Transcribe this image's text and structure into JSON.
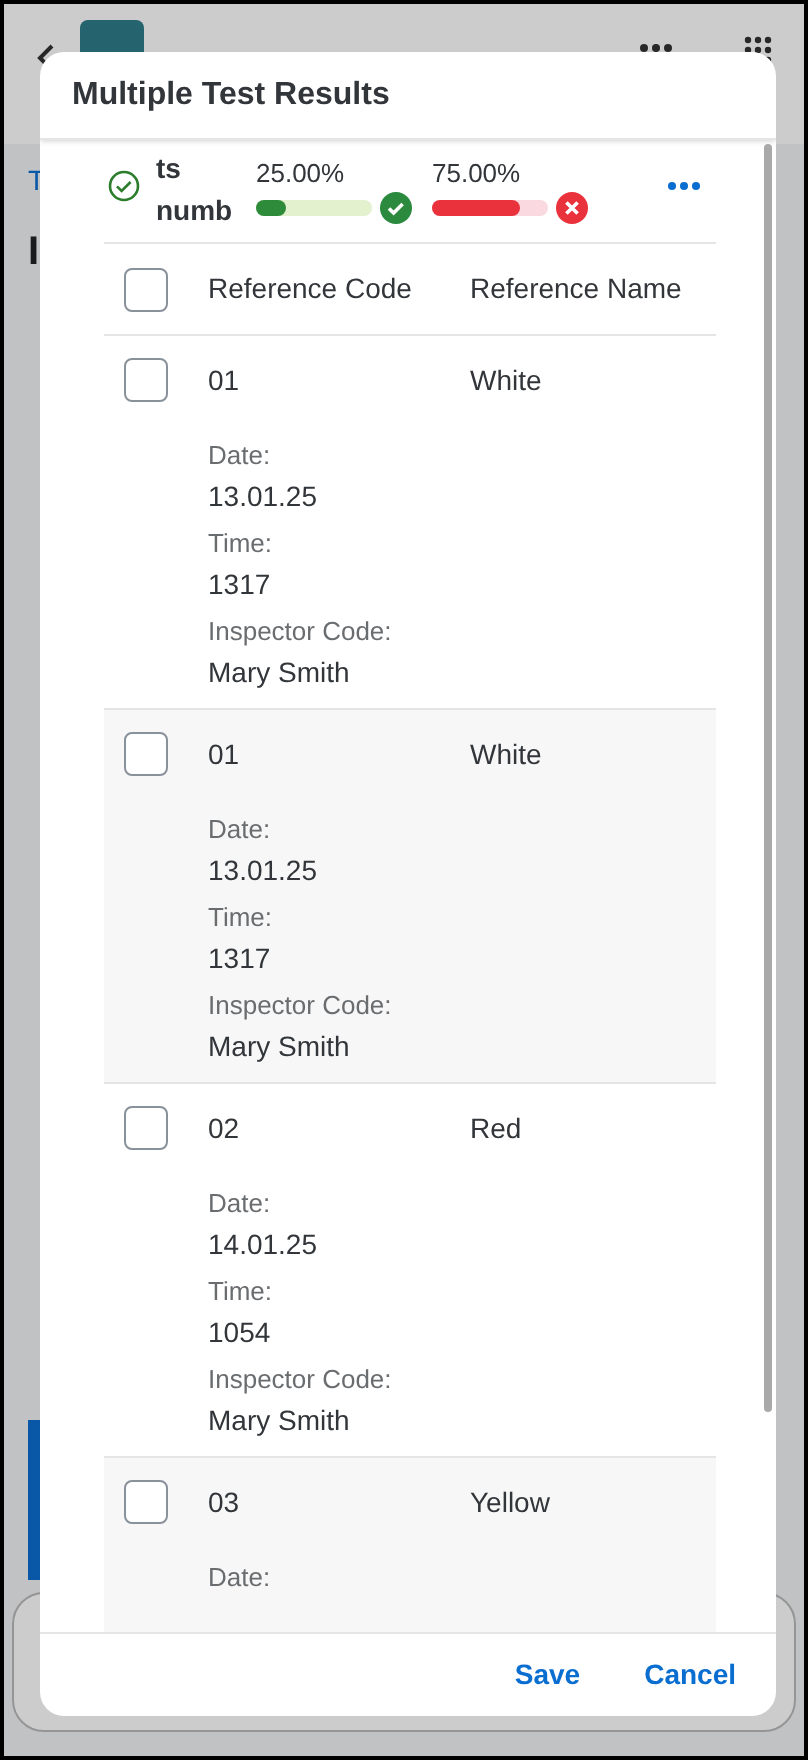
{
  "background": {
    "fragments": [
      "T",
      "I"
    ]
  },
  "dialog": {
    "title": "Multiple Test Results",
    "summary": {
      "label": "ts numb",
      "results": [
        {
          "reading": "25.00%",
          "level": 0.25,
          "kind": "pass"
        },
        {
          "reading": "75.00%",
          "level": 0.75,
          "kind": "fail"
        }
      ]
    },
    "table": {
      "columns": [
        "Reference Code",
        "Reference Name"
      ],
      "header_checked": false,
      "rows": [
        {
          "checked": false,
          "code": "01",
          "name": "White",
          "details": [
            {
              "label": "Date:",
              "value": "13.01.25"
            },
            {
              "label": "Time:",
              "value": "1317"
            },
            {
              "label": "Inspector Code:",
              "value": "Mary Smith"
            }
          ]
        },
        {
          "checked": false,
          "code": "01",
          "name": "White",
          "details": [
            {
              "label": "Date:",
              "value": "13.01.25"
            },
            {
              "label": "Time:",
              "value": "1317"
            },
            {
              "label": "Inspector Code:",
              "value": "Mary Smith"
            }
          ]
        },
        {
          "checked": false,
          "code": "02",
          "name": "Red",
          "details": [
            {
              "label": "Date:",
              "value": "14.01.25"
            },
            {
              "label": "Time:",
              "value": "1054"
            },
            {
              "label": "Inspector Code:",
              "value": "Mary Smith"
            }
          ]
        },
        {
          "checked": false,
          "code": "03",
          "name": "Yellow",
          "details": [
            {
              "label": "Date:"
            }
          ]
        }
      ]
    },
    "buttons": [
      "Save",
      "Cancel"
    ]
  }
}
